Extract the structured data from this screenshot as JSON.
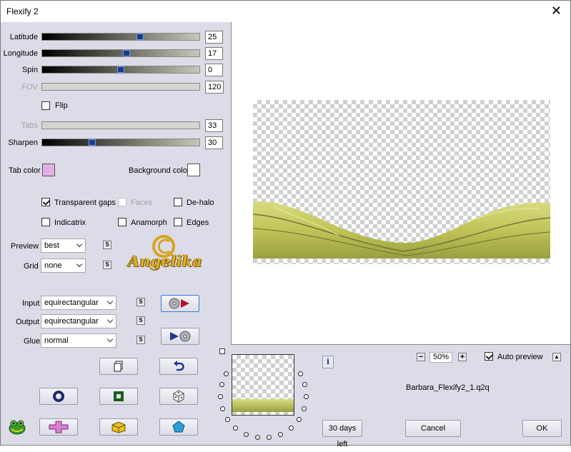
{
  "window": {
    "title": "Flexify 2",
    "close_glyph": "✕"
  },
  "sliders": [
    {
      "key": "latitude",
      "label": "Latitude",
      "value": "25",
      "level": 0.63,
      "enabled": true
    },
    {
      "key": "longitude",
      "label": "Longitude",
      "value": "17",
      "level": 0.54,
      "enabled": true
    },
    {
      "key": "spin",
      "label": "Spin",
      "value": "0",
      "level": 0.5,
      "enabled": true
    },
    {
      "key": "fov",
      "label": "FOV",
      "value": "120",
      "level": null,
      "enabled": false
    },
    {
      "key": "tabs",
      "label": "Tabs",
      "value": "33",
      "level": null,
      "enabled": false
    },
    {
      "key": "sharpen",
      "label": "Sharpen",
      "value": "30",
      "level": 0.31,
      "enabled": true
    }
  ],
  "flip": {
    "label": "Flip",
    "checked": false
  },
  "tab_color": {
    "label": "Tab color",
    "color": "#e0b0e0"
  },
  "background_color": {
    "label": "Background color",
    "color": "#ffffff"
  },
  "options": {
    "transparent_gaps": {
      "label": "Transparent gaps",
      "checked": true
    },
    "faces": {
      "label": "Faces",
      "checked": false
    },
    "de_halo": {
      "label": "De-halo",
      "checked": false
    },
    "indicatrix": {
      "label": "Indicatrix",
      "checked": false
    },
    "anamorph": {
      "label": "Anamorph",
      "checked": false
    },
    "edges": {
      "label": "Edges",
      "checked": false
    }
  },
  "preview_select": {
    "label": "Preview",
    "value": "best"
  },
  "grid_select": {
    "label": "Grid",
    "value": "none"
  },
  "input_select": {
    "label": "Input",
    "value": "equirectangular"
  },
  "output_select": {
    "label": "Output",
    "value": "equirectangular"
  },
  "glue_select": {
    "label": "Glue",
    "value": "normal"
  },
  "s_button": "S",
  "watermark": {
    "text": "Angelika"
  },
  "zoom": {
    "minus": "−",
    "value": "50%",
    "plus": "+"
  },
  "auto_preview": {
    "label": "Auto preview",
    "checked": true
  },
  "preset_file": "Barbara_Flexify2_1.q2q",
  "info_glyph": "i",
  "buttons": {
    "days_left": "30 days left",
    "cancel": "Cancel",
    "ok": "OK"
  },
  "colors": {
    "accent": "#1e3a8c",
    "landscape": "#c8cc60",
    "panel": "#dcdce8"
  }
}
